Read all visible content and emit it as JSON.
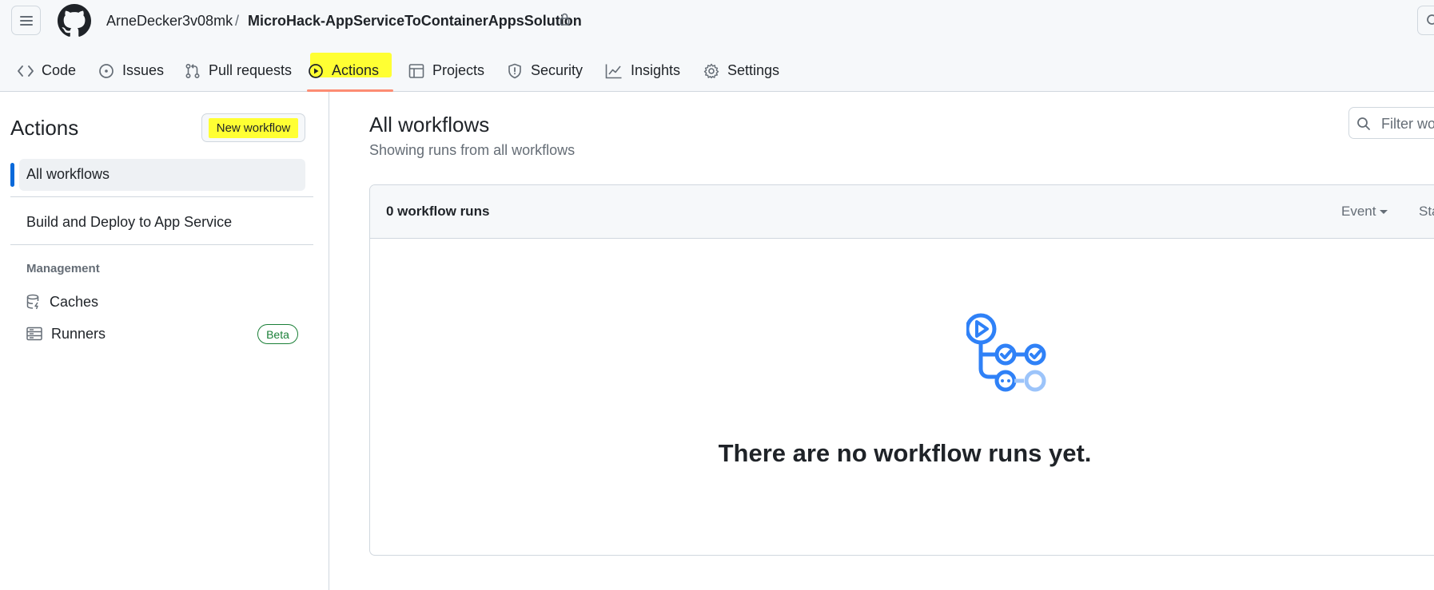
{
  "header": {
    "owner": "ArneDecker3v08mk",
    "separator": "/",
    "repo": "MicroHack-AppServiceToContainerAppsSolution"
  },
  "tabs": [
    {
      "label": "Code",
      "icon": "code-icon"
    },
    {
      "label": "Issues",
      "icon": "issue-opened-icon"
    },
    {
      "label": "Pull requests",
      "icon": "git-pull-request-icon"
    },
    {
      "label": "Actions",
      "icon": "play-icon",
      "active": true
    },
    {
      "label": "Projects",
      "icon": "table-icon"
    },
    {
      "label": "Security",
      "icon": "shield-icon"
    },
    {
      "label": "Insights",
      "icon": "graph-icon"
    },
    {
      "label": "Settings",
      "icon": "gear-icon"
    }
  ],
  "sidebar": {
    "title": "Actions",
    "new_workflow_label": "New workflow",
    "all_workflows_label": "All workflows",
    "workflows": [
      "Build and Deploy to App Service"
    ],
    "management_heading": "Management",
    "management_items": [
      {
        "label": "Caches",
        "icon": "database-icon"
      },
      {
        "label": "Runners",
        "icon": "server-icon",
        "badge": "Beta"
      }
    ]
  },
  "main": {
    "title": "All workflows",
    "subtitle": "Showing runs from all workflows",
    "filter_placeholder": "Filter wo",
    "runs_count": "0 workflow runs",
    "event_filter": "Event",
    "status_filter": "Sta",
    "empty_message": "There are no workflow runs yet."
  },
  "colors": {
    "highlight": "#ffff33",
    "accent_blue": "#0969da",
    "active_tab_underline": "#fd8c73",
    "beta_green": "#1a7f37",
    "empty_icon_blue": "#2f81f7"
  }
}
